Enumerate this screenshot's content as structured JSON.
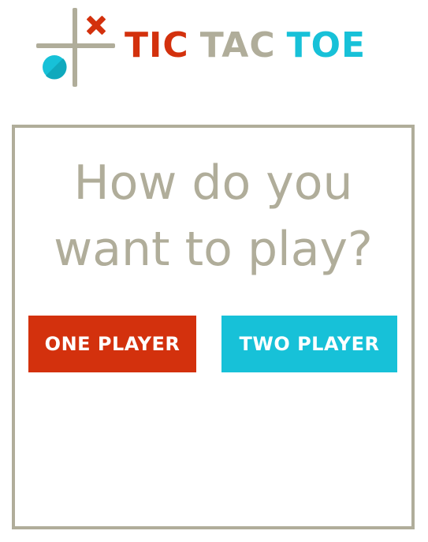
{
  "header": {
    "title_word_1": "TIC",
    "title_word_2": "TAC",
    "title_word_3": "TOE",
    "logo_icon": "tic-tac-toe-logo-icon"
  },
  "main": {
    "question": "How do you want to play?",
    "buttons": {
      "one_player": "ONE PLAYER",
      "two_player": "TWO PLAYER"
    }
  },
  "colors": {
    "red": "#d3310d",
    "gray": "#b0ad9a",
    "cyan": "#17c1d8",
    "background": "#ffffff"
  }
}
